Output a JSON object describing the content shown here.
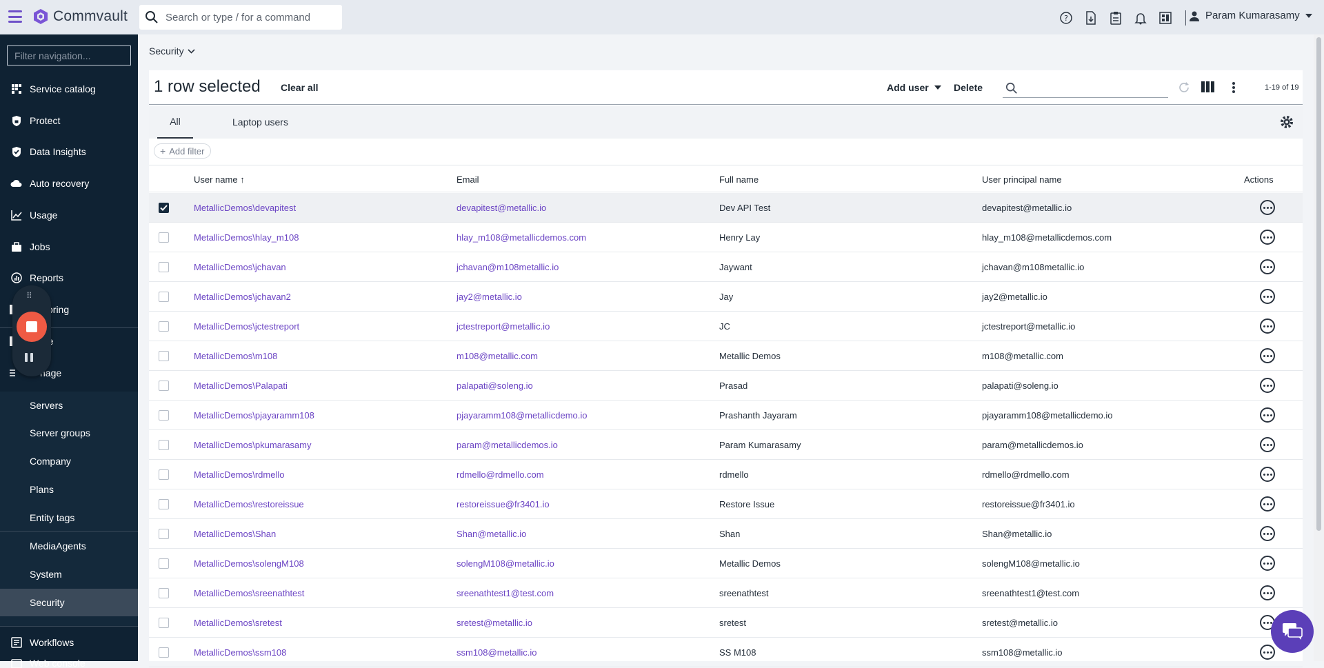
{
  "header": {
    "app_name": "Commvault",
    "search_placeholder": "Search or type / for a command",
    "user_name": "Param Kumarasamy",
    "icons": [
      "help-icon",
      "document-icon",
      "clipboard-icon",
      "bell-icon",
      "dashboard-icon"
    ]
  },
  "sidebar": {
    "filter_placeholder": "Filter navigation...",
    "items": [
      {
        "label": "Service catalog",
        "icon": "grid-icon"
      },
      {
        "label": "Protect",
        "icon": "shield-lock-icon"
      },
      {
        "label": "Data Insights",
        "icon": "shield-check-icon"
      },
      {
        "label": "Auto recovery",
        "icon": "cloud-recovery-icon"
      },
      {
        "label": "Usage",
        "icon": "chart-line-icon"
      },
      {
        "label": "Jobs",
        "icon": "briefcase-icon"
      },
      {
        "label": "Reports",
        "icon": "reports-icon"
      },
      {
        "label": "coring",
        "icon": "monitoring-icon"
      },
      {
        "label": "ge",
        "icon": "storage-icon"
      },
      {
        "label": "nage",
        "icon": "manage-icon"
      }
    ],
    "sub_items": [
      "Servers",
      "Server groups",
      "Company",
      "Plans",
      "Entity tags",
      "MediaAgents",
      "System",
      "Security"
    ],
    "bottom_items": [
      {
        "label": "Workflows",
        "icon": "workflow-icon"
      },
      {
        "label": "Web console",
        "icon": "console-icon"
      }
    ],
    "active_sub": "Security"
  },
  "breadcrumb": {
    "label": "Security"
  },
  "toolbar": {
    "selected_text": "1 row selected",
    "clear_all": "Clear all",
    "add_user": "Add user",
    "delete": "Delete",
    "pager": "1-19 of 19"
  },
  "tabs": [
    {
      "label": "All",
      "active": true
    },
    {
      "label": "Laptop users",
      "active": false
    }
  ],
  "filter": {
    "add_filter": "Add filter"
  },
  "table": {
    "columns": [
      "User name",
      "Email",
      "Full name",
      "User principal name",
      "Actions"
    ],
    "sort_indicator": "↑",
    "rows": [
      {
        "user": "MetallicDemos\\devapitest",
        "email": "devapitest@metallic.io",
        "full": "Dev API Test",
        "upn": "devapitest@metallic.io",
        "checked": true
      },
      {
        "user": "MetallicDemos\\hlay_m108",
        "email": "hlay_m108@metallicdemos.com",
        "full": "Henry Lay",
        "upn": "hlay_m108@metallicdemos.com",
        "checked": false
      },
      {
        "user": "MetallicDemos\\jchavan",
        "email": "jchavan@m108metallic.io",
        "full": "Jaywant",
        "upn": "jchavan@m108metallic.io",
        "checked": false
      },
      {
        "user": "MetallicDemos\\jchavan2",
        "email": "jay2@metallic.io",
        "full": "Jay",
        "upn": "jay2@metallic.io",
        "checked": false
      },
      {
        "user": "MetallicDemos\\jctestreport",
        "email": "jctestreport@metallic.io",
        "full": "JC",
        "upn": "jctestreport@metallic.io",
        "checked": false
      },
      {
        "user": "MetallicDemos\\m108",
        "email": "m108@metallic.com",
        "full": "Metallic Demos",
        "upn": "m108@metallic.com",
        "checked": false
      },
      {
        "user": "MetallicDemos\\Palapati",
        "email": "palapati@soleng.io",
        "full": "Prasad",
        "upn": "palapati@soleng.io",
        "checked": false
      },
      {
        "user": "MetallicDemos\\pjayaramm108",
        "email": "pjayaramm108@metallicdemo.io",
        "full": "Prashanth Jayaram",
        "upn": "pjayaramm108@metallicdemo.io",
        "checked": false
      },
      {
        "user": "MetallicDemos\\pkumarasamy",
        "email": "param@metallicdemos.io",
        "full": "Param Kumarasamy",
        "upn": "param@metallicdemos.io",
        "checked": false
      },
      {
        "user": "MetallicDemos\\rdmello",
        "email": "rdmello@rdmello.com",
        "full": "rdmello",
        "upn": "rdmello@rdmello.com",
        "checked": false
      },
      {
        "user": "MetallicDemos\\restoreissue",
        "email": "restoreissue@fr3401.io",
        "full": "Restore Issue",
        "upn": "restoreissue@fr3401.io",
        "checked": false
      },
      {
        "user": "MetallicDemos\\Shan",
        "email": "Shan@metallic.io",
        "full": "Shan",
        "upn": "Shan@metallic.io",
        "checked": false
      },
      {
        "user": "MetallicDemos\\solengM108",
        "email": "solengM108@metallic.io",
        "full": "Metallic Demos",
        "upn": "solengM108@metallic.io",
        "checked": false
      },
      {
        "user": "MetallicDemos\\sreenathtest",
        "email": "sreenathtest1@test.com",
        "full": "sreenathtest",
        "upn": "sreenathtest1@test.com",
        "checked": false
      },
      {
        "user": "MetallicDemos\\sretest",
        "email": "sretest@metallic.io",
        "full": "sretest",
        "upn": "sretest@metallic.io",
        "checked": false
      },
      {
        "user": "MetallicDemos\\ssm108",
        "email": "ssm108@metallic.io",
        "full": "SS M108",
        "upn": "ssm108@metallic.io",
        "checked": false
      }
    ]
  },
  "colors": {
    "accent": "#6b44c4",
    "sidebar_bg": "#0f2233",
    "stop": "#ef5a44",
    "chat": "#5b3fb8"
  }
}
